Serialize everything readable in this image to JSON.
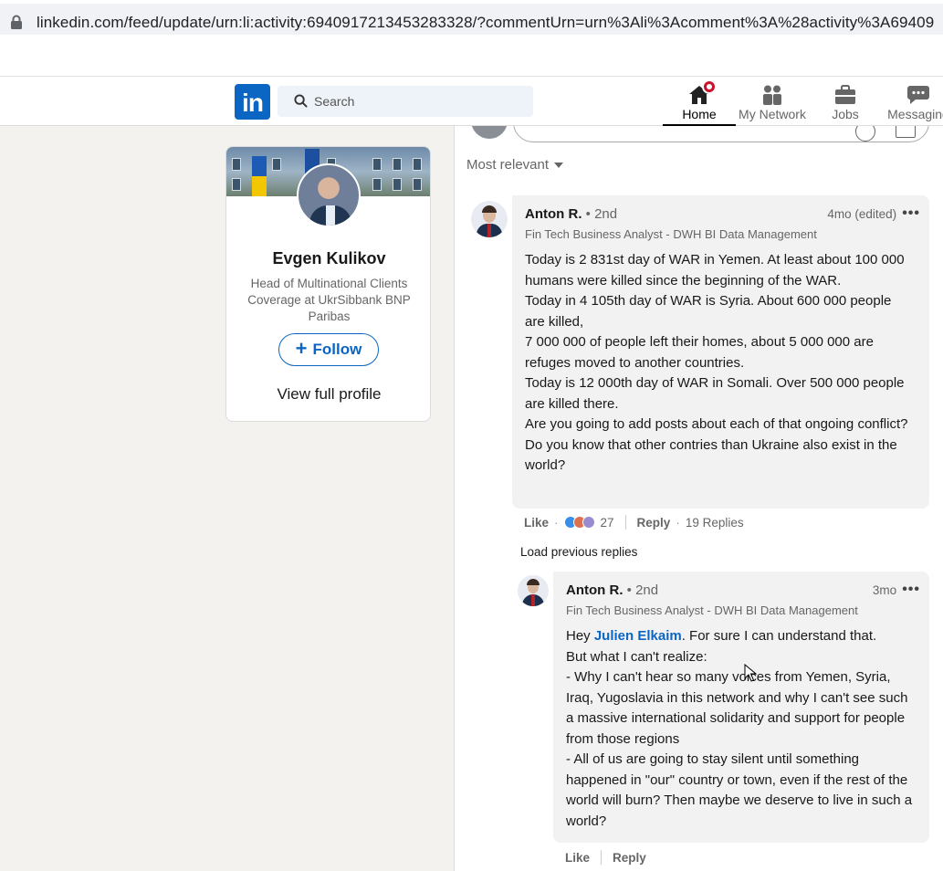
{
  "browser": {
    "url": "linkedin.com/feed/update/urn:li:activity:6940917213453283328/?commentUrn=urn%3Ali%3Acomment%3A%28activity%3A69409"
  },
  "nav": {
    "logo": "in",
    "search_placeholder": "Search",
    "items": [
      {
        "label": "Home"
      },
      {
        "label": "My Network"
      },
      {
        "label": "Jobs"
      },
      {
        "label": "Messaging"
      }
    ]
  },
  "profile": {
    "name": "Evgen Kulikov",
    "headline": "Head of Multinational Clients Coverage at UkrSibbank BNP Paribas",
    "follow_label": "Follow",
    "view_profile_label": "View full profile"
  },
  "comments": {
    "sort_label": "Most relevant",
    "load_previous_label": "Load previous replies",
    "main": {
      "author": "Anton R.",
      "degree": "• 2nd",
      "headline": "Fin Tech Business Analyst - DWH BI Data Management",
      "time": "4mo (edited)",
      "lines": [
        "Today is 2 831st day of WAR in Yemen. At least about 100 000 humans were killed since the beginning of the WAR.",
        "Today in 4 105th day of WAR is Syria. About 600 000 people are killed,",
        "7 000 000 of people left their homes, about 5 000 000 are refuges moved to another countries.",
        "Today is 12 000th day of WAR in Somali. Over 500 000 people are killed there.",
        "Are you going to add posts about each of that ongoing conflict?",
        "Do you know that other contries than Ukraine also exist in the world?"
      ],
      "like_label": "Like",
      "reaction_count": "27",
      "reply_label": "Reply",
      "replies_label": "19 Replies"
    },
    "reply": {
      "author": "Anton R.",
      "degree": "• 2nd",
      "headline": "Fin Tech Business Analyst - DWH BI Data Management",
      "time": "3mo",
      "greeting": "Hey ",
      "mention": "Julien Elkaim",
      "greeting_rest": ". For sure I can understand that.",
      "lines": [
        "But what I can't realize:",
        "- Why I can't hear so many voices from Yemen, Syria, Iraq, Yugoslavia in this network and why I can't see such a massive international solidarity and support for people from those regions",
        "- All of us are going to stay silent until something happened in \"our\" country or town, even if the rest of the world will burn? Then maybe we deserve to live in such a world?"
      ],
      "like_label": "Like",
      "reply_label": "Reply"
    }
  }
}
